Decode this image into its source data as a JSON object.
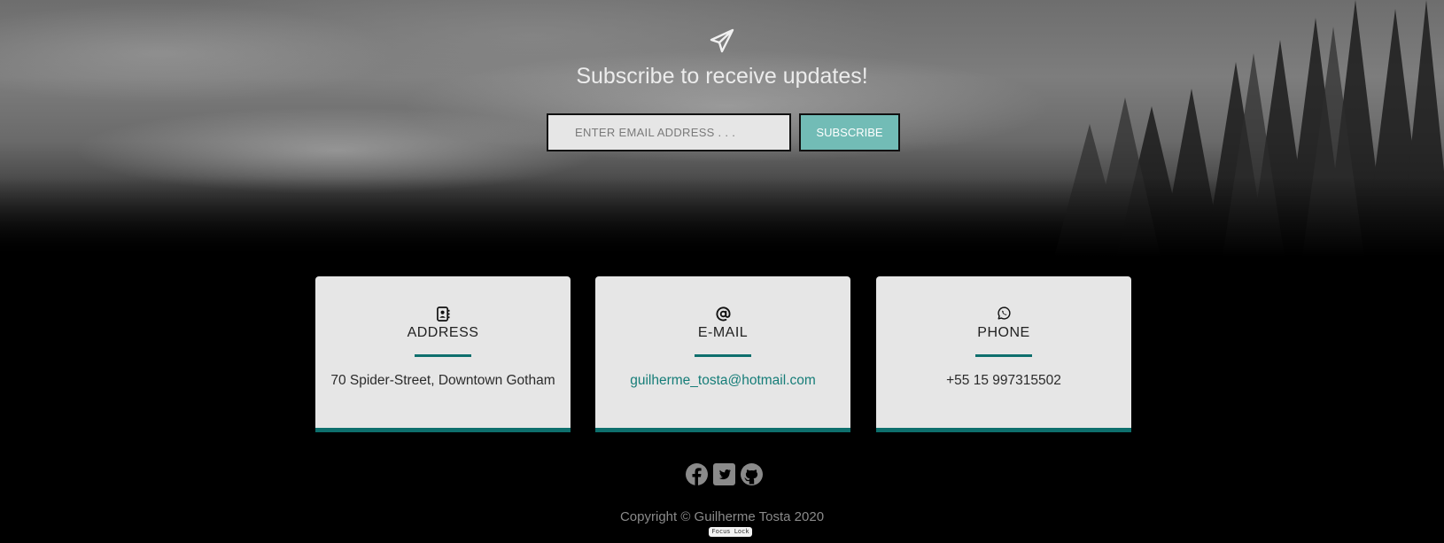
{
  "subscribe": {
    "title": "Subscribe to receive updates!",
    "email_placeholder": "ENTER EMAIL ADDRESS . . .",
    "button_label": "SUBSCRIBE",
    "icon": "paper-plane-icon"
  },
  "contact_cards": [
    {
      "icon": "address-book-icon",
      "heading": "ADDRESS",
      "value": "70 Spider-Street, Downtown Gotham"
    },
    {
      "icon": "at-sign-icon",
      "heading": "E-MAIL",
      "value": "guilherme_tosta@hotmail.com"
    },
    {
      "icon": "whatsapp-icon",
      "heading": "PHONE",
      "value": "+55 15 997315502"
    }
  ],
  "social_icons": [
    "facebook-icon",
    "twitter-icon",
    "github-icon"
  ],
  "footer": {
    "copyright": "Copyright © Guilherme Tosta 2020",
    "focus_lock_badge": "Focus Lock"
  },
  "colors": {
    "accent": "#0e6f6d",
    "button": "#72bcb6",
    "card_background": "#e6e6e6",
    "page_background": "#000000"
  }
}
